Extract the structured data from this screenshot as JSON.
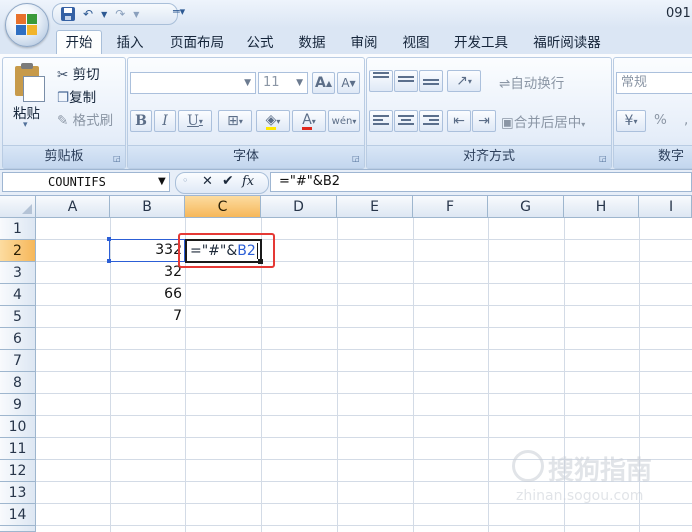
{
  "title": "091",
  "tabs": [
    "开始",
    "插入",
    "页面布局",
    "公式",
    "数据",
    "审阅",
    "视图",
    "开发工具",
    "福昕阅读器"
  ],
  "clipboard": {
    "paste": "粘贴",
    "cut": "剪切",
    "copy": "复制",
    "painter": "格式刷",
    "title": "剪贴板"
  },
  "font": {
    "size": "11",
    "title": "字体",
    "bold": "B",
    "italic": "I",
    "underline": "U",
    "grow": "A",
    "shrink": "A",
    "color_letter": "A",
    "phonetic": "wén"
  },
  "alignment": {
    "wrap": "自动换行",
    "merge": "合并后居中",
    "title": "对齐方式"
  },
  "number": {
    "format": "常规",
    "percent": "%",
    "title": "数字"
  },
  "formula_bar": {
    "name_box": "COUNTIFS",
    "fx": "fx",
    "formula": "=\"#\"&B2",
    "cancel": "✕",
    "enter": "✔"
  },
  "columns": [
    "A",
    "B",
    "C",
    "D",
    "E",
    "F",
    "G",
    "H",
    "I"
  ],
  "rows": [
    "1",
    "2",
    "3",
    "4",
    "5",
    "6",
    "7",
    "8",
    "9",
    "10",
    "11",
    "12",
    "13",
    "14"
  ],
  "cells": {
    "B2": "332",
    "B3": "32",
    "B4": "66",
    "B5": "7"
  },
  "edit_cell": {
    "prefix": "=\"#\"&",
    "ref": "B2"
  },
  "watermark": {
    "main": "搜狗指南",
    "sub": "zhinan.sogou.com"
  },
  "colors": {
    "accent": "#3561a4",
    "selection_header": "#f6b75a",
    "highlight_box": "#e53935",
    "ref_blue": "#2c5fd6"
  }
}
